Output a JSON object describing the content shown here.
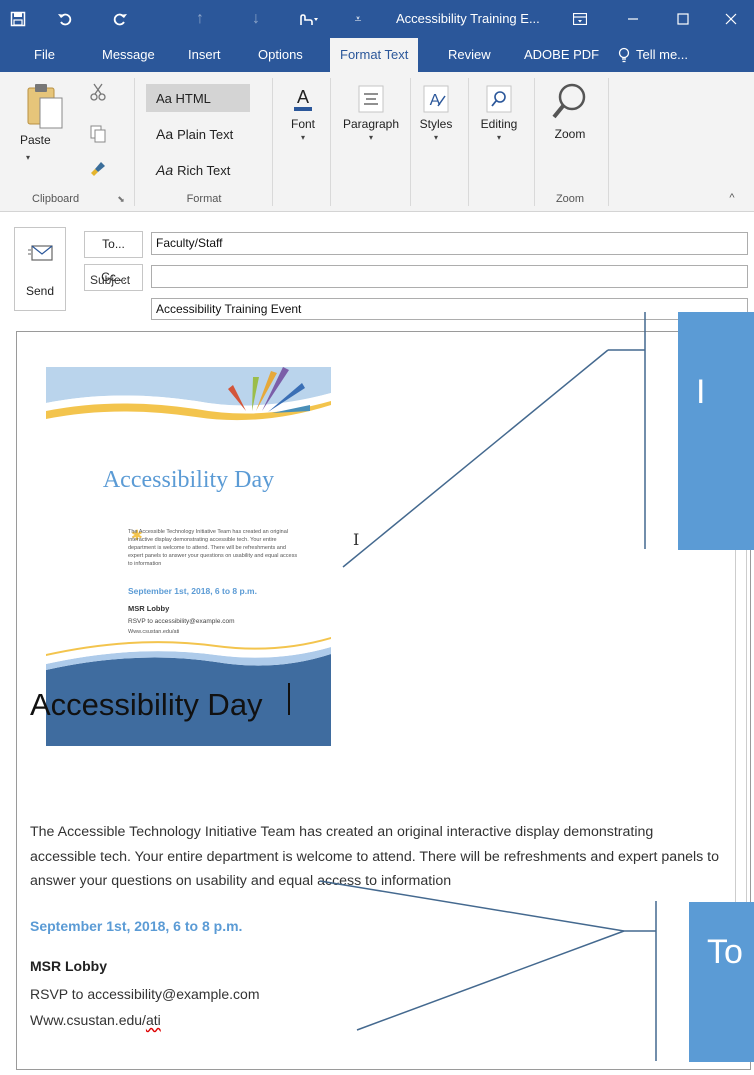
{
  "window": {
    "title": "Accessibility Training E...",
    "controls": [
      "minimize",
      "maximize",
      "close"
    ]
  },
  "quick_access": [
    "save-icon",
    "undo-icon",
    "redo-icon",
    "up-arrow-icon",
    "down-arrow-icon",
    "touch-mode-icon",
    "customize-icon"
  ],
  "tabs": [
    {
      "label": "File"
    },
    {
      "label": "Message"
    },
    {
      "label": "Insert"
    },
    {
      "label": "Options"
    },
    {
      "label": "Format Text"
    },
    {
      "label": "Review"
    },
    {
      "label": "ADOBE PDF"
    },
    {
      "label": "Tell me..."
    }
  ],
  "active_tab": "Format Text",
  "ribbon": {
    "clipboard": {
      "paste": "Paste",
      "group": "Clipboard"
    },
    "format": {
      "html": "Aa HTML",
      "plain": "Plain Text",
      "rich": "Rich Text",
      "group": "Format",
      "selected": "HTML"
    },
    "font": "Font",
    "paragraph": "Paragraph",
    "styles": "Styles",
    "editing": "Editing",
    "zoom": {
      "button": "Zoom",
      "group": "Zoom"
    }
  },
  "compose": {
    "send": "Send",
    "to_button": "To...",
    "cc_button": "Cc...",
    "subject_label": "Subject",
    "to_value": "Faculty/Staff",
    "cc_value": "",
    "subject_value": "Accessibility Training Event"
  },
  "flyer": {
    "title": "Accessibility Day",
    "desc": "The Accessible Technology Initiative Team has created an original interactive display demonstrating accessible tech. Your entire department is welcome to attend. There will be refreshments and expert panels to answer your questions on usability and equal access to information",
    "date": "September 1st, 2018, 6 to 8 p.m.",
    "location": "MSR Lobby",
    "rsvp": "RSVP to accessibility@example.com",
    "web": "Www.csustan.edu/ati"
  },
  "body": {
    "heading": "Accessibility Day",
    "paragraph": "The Accessible Technology Initiative Team has created an original interactive display demonstrating accessible tech. Your entire department is welcome to attend. There will be refreshments and expert panels to answer your questions on usability and equal access to information",
    "date": "September 1st, 2018, 6 to 8 p.m.",
    "location": "MSR Lobby",
    "rsvp": "RSVP to accessibility@example.com",
    "web_prefix": "Www.csustan.edu/",
    "web_suffix": "ati"
  },
  "callouts": {
    "top": "I",
    "bottom": "To"
  },
  "colors": {
    "titlebar": "#2b579a",
    "ribbon": "#f3f3f3",
    "accent_blue": "#5b9bd5",
    "callout": "#5b9bd5"
  }
}
